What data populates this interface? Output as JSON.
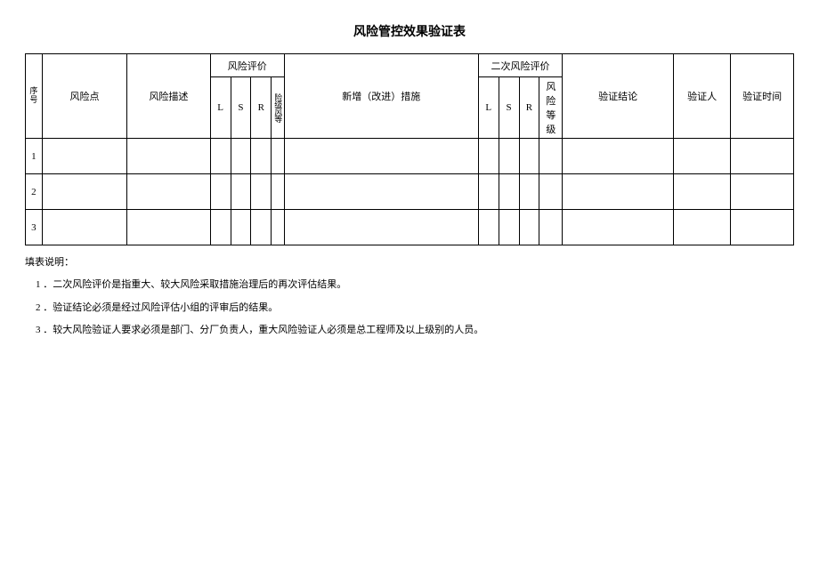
{
  "title": "风险管控效果验证表",
  "headers": {
    "seq": "序号",
    "risk_point": "风险点",
    "risk_desc": "风险描述",
    "risk_eval": "风险评价",
    "L": "L",
    "S": "S",
    "R": "R",
    "level": "险级风等",
    "measure": "新增（改进）措施",
    "second_eval": "二次风险评价",
    "level2": "风险等级",
    "conclusion": "验证结论",
    "person": "验证人",
    "time": "验证时间"
  },
  "rows": [
    {
      "seq": "1"
    },
    {
      "seq": "2"
    },
    {
      "seq": "3"
    }
  ],
  "notes": {
    "intro": "填表说明：",
    "n1": "1 ．二次风险评价是指重大、较大风险采取措施治理后的再次评估结果。",
    "n2": "2 ．验证结论必须是经过风险评估小组的评审后的结果。",
    "n3": "3 ．较大风险验证人要求必须是部门、分厂负责人，重大风险验证人必须是总工程师及以上级别的人员。"
  }
}
